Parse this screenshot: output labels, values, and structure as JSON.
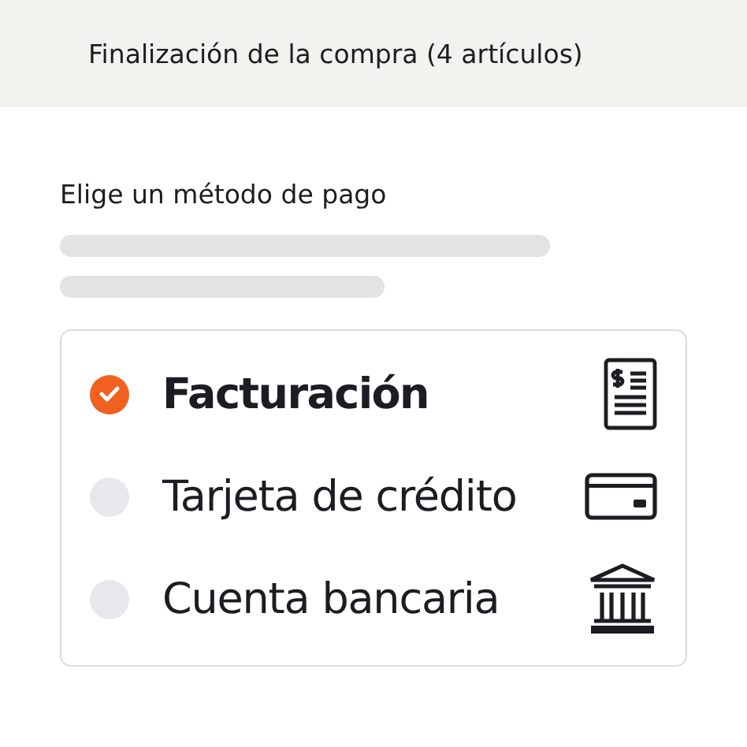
{
  "header": {
    "title": "Finalización de la compra (4 artículos)"
  },
  "section": {
    "heading": "Elige un método de pago"
  },
  "methods": [
    {
      "label": "Facturación",
      "selected": true,
      "kind": "invoice"
    },
    {
      "label": "Tarjeta de crédito",
      "selected": false,
      "kind": "card"
    },
    {
      "label": "Cuenta bancaria",
      "selected": false,
      "kind": "bank"
    }
  ]
}
